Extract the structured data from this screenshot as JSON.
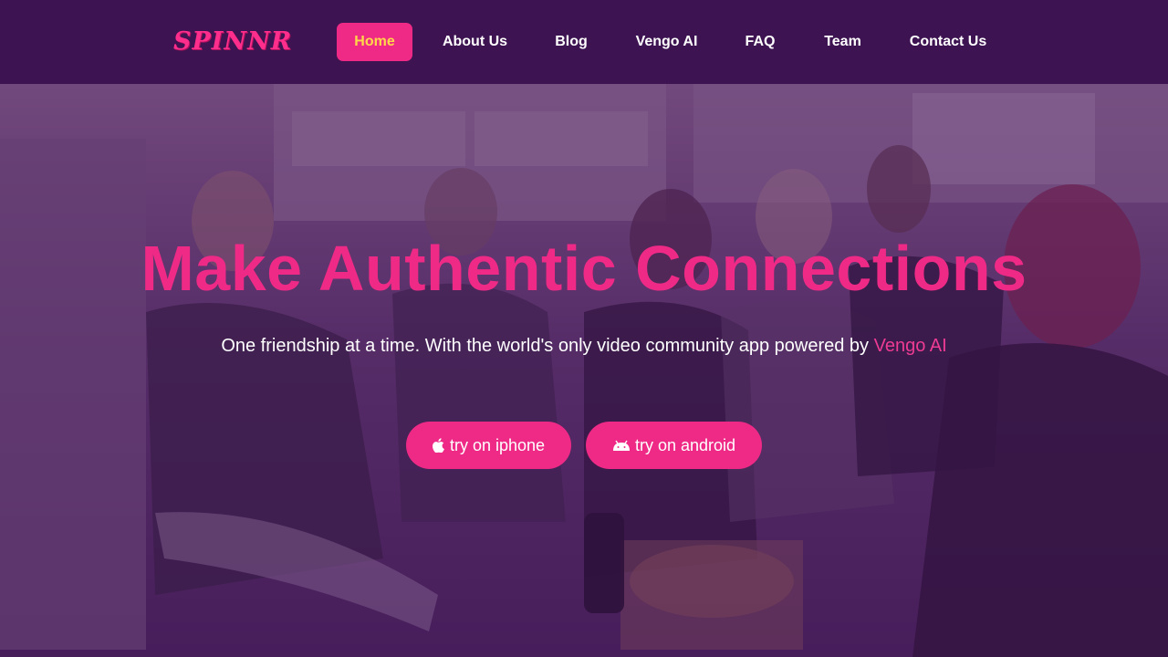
{
  "brand": {
    "name": "SPINNR",
    "accent": "#ee2a86",
    "nav_bg": "#3d1451"
  },
  "nav": {
    "items": [
      {
        "label": "Home",
        "active": true
      },
      {
        "label": "About Us"
      },
      {
        "label": "Blog"
      },
      {
        "label": "Vengo AI"
      },
      {
        "label": "FAQ"
      },
      {
        "label": "Team"
      },
      {
        "label": "Contact Us"
      }
    ]
  },
  "hero": {
    "title": "Make Authentic Connections",
    "subtitle": "One friendship at a time. With the world's only video community app powered by",
    "subtitle_link": "Vengo AI",
    "buttons": [
      {
        "label": "try on iphone",
        "icon": "apple-icon"
      },
      {
        "label": "try on android",
        "icon": "android-icon"
      }
    ]
  }
}
